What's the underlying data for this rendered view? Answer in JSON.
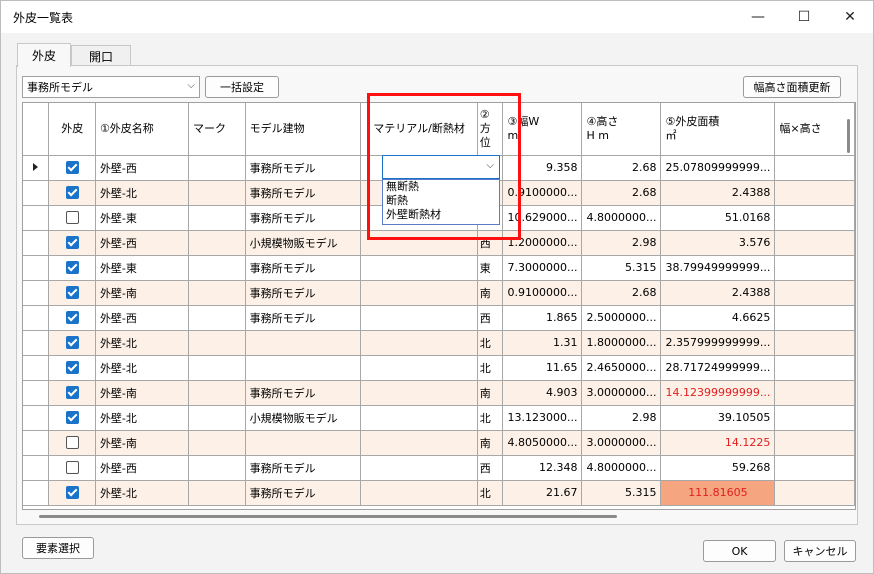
{
  "window": {
    "title": "外皮一覧表",
    "min_glyph": "—",
    "max_glyph": "☐",
    "close_glyph": "✕"
  },
  "tabs": [
    {
      "label": "外皮"
    },
    {
      "label": "開口"
    }
  ],
  "toolbar": {
    "model_select": "事務所モデル",
    "bulk_button": "一括設定",
    "update_button": "幅高さ面積更新"
  },
  "columns": [
    "外皮",
    "①外皮名称",
    "マーク",
    "モデル建物",
    "マテリアル/断熱材",
    "②\n方\n位",
    "③幅W\nm",
    "④高さ\nH m",
    "⑤外皮面積\n㎡",
    "幅×高さ"
  ],
  "rows": [
    {
      "checked": true,
      "name": "外壁-西",
      "mark": "",
      "model": "事務所モデル",
      "material": "",
      "dir": "西",
      "w": "9.358",
      "h": "2.68",
      "area": "25.07809999999..."
    },
    {
      "checked": true,
      "name": "外壁-北",
      "mark": "",
      "model": "事務所モデル",
      "material": "",
      "dir": "北",
      "w": "0.9100000...",
      "h": "2.68",
      "area": "2.4388"
    },
    {
      "checked": false,
      "name": "外壁-東",
      "mark": "",
      "model": "事務所モデル",
      "material": "",
      "dir": "東",
      "w": "10.629000...",
      "h": "4.8000000...",
      "area": "51.0168"
    },
    {
      "checked": true,
      "name": "外壁-西",
      "mark": "",
      "model": "小規模物販モデル",
      "material": "",
      "dir": "西",
      "w": "1.2000000...",
      "h": "2.98",
      "area": "3.576"
    },
    {
      "checked": true,
      "name": "外壁-東",
      "mark": "",
      "model": "事務所モデル",
      "material": "",
      "dir": "東",
      "w": "7.3000000...",
      "h": "5.315",
      "area": "38.79949999999..."
    },
    {
      "checked": true,
      "name": "外壁-南",
      "mark": "",
      "model": "事務所モデル",
      "material": "",
      "dir": "南",
      "w": "0.9100000...",
      "h": "2.68",
      "area": "2.4388"
    },
    {
      "checked": true,
      "name": "外壁-西",
      "mark": "",
      "model": "事務所モデル",
      "material": "",
      "dir": "西",
      "w": "1.865",
      "h": "2.5000000...",
      "area": "4.6625"
    },
    {
      "checked": true,
      "name": "外壁-北",
      "mark": "",
      "model": "",
      "material": "",
      "dir": "北",
      "w": "1.31",
      "h": "1.8000000...",
      "area": "2.357999999999..."
    },
    {
      "checked": true,
      "name": "外壁-北",
      "mark": "",
      "model": "",
      "material": "",
      "dir": "北",
      "w": "11.65",
      "h": "2.4650000...",
      "area": "28.71724999999..."
    },
    {
      "checked": true,
      "name": "外壁-南",
      "mark": "",
      "model": "事務所モデル",
      "material": "",
      "dir": "南",
      "w": "4.903",
      "h": "3.0000000...",
      "area": "14.12399999999...",
      "area_red": true
    },
    {
      "checked": true,
      "name": "外壁-北",
      "mark": "",
      "model": "小規模物販モデル",
      "material": "",
      "dir": "北",
      "w": "13.123000...",
      "h": "2.98",
      "area": "39.10505"
    },
    {
      "checked": false,
      "name": "外壁-南",
      "mark": "",
      "model": "",
      "material": "",
      "dir": "南",
      "w": "4.8050000...",
      "h": "3.0000000...",
      "area": "14.1225",
      "area_red": true
    },
    {
      "checked": false,
      "name": "外壁-西",
      "mark": "",
      "model": "事務所モデル",
      "material": "",
      "dir": "西",
      "w": "12.348",
      "h": "4.8000000...",
      "area": "59.268"
    },
    {
      "checked": true,
      "name": "外壁-北",
      "mark": "",
      "model": "事務所モデル",
      "material": "",
      "dir": "北",
      "w": "21.67",
      "h": "5.315",
      "area": "111.81605",
      "area_hl": true
    }
  ],
  "dropdown": {
    "options": [
      "無断熱",
      "断熱",
      "外壁断熱材"
    ]
  },
  "footer": {
    "select_button": "要素選択",
    "ok_button": "OK",
    "cancel_button": "キャンセル"
  },
  "colors": {
    "accent": "#1a73c8",
    "alt_row": "#fdf0e6",
    "highlight": "#f5a57f",
    "warn_text": "#e02020",
    "annotation": "#ff1010"
  }
}
